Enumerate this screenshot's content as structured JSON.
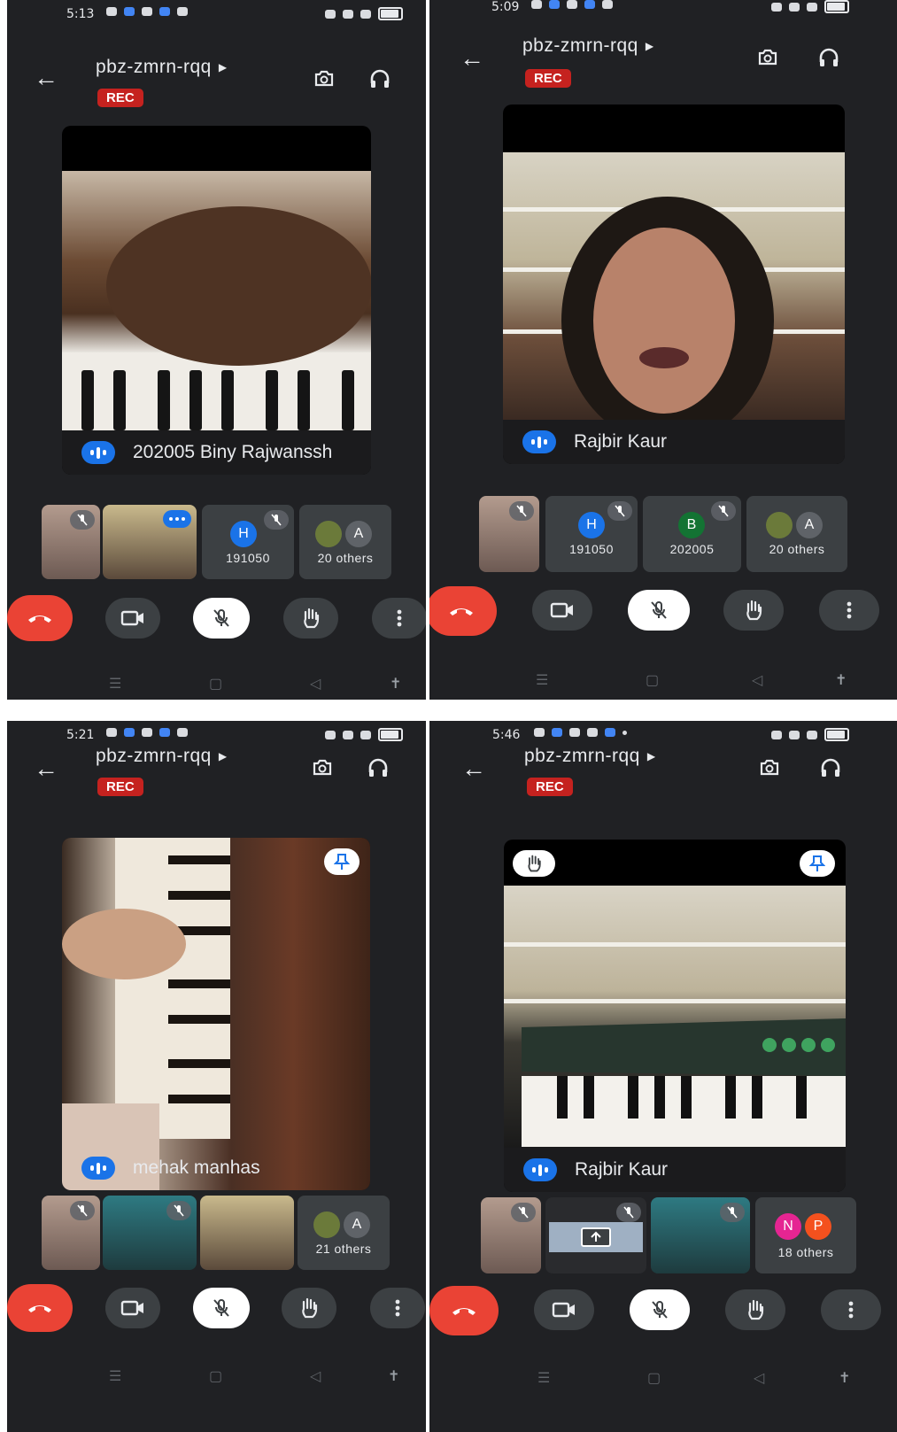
{
  "call": {
    "meeting_code": "pbz-zmrn-rqq",
    "rec_label": "REC"
  },
  "screens": [
    {
      "time": "5:13",
      "main_name": "202005 Biny Rajwanssh",
      "tiles": [
        {
          "type": "video",
          "muted": true
        },
        {
          "type": "video",
          "more": true
        },
        {
          "type": "avatar",
          "letter": "H",
          "color": "#1a73e8",
          "label": "191050",
          "muted": true
        },
        {
          "type": "others",
          "letter": "A",
          "color": "#5f6368",
          "label": "20 others"
        }
      ]
    },
    {
      "time": "5:09",
      "main_name": "Rajbir Kaur",
      "tiles": [
        {
          "type": "video",
          "muted": true
        },
        {
          "type": "avatar",
          "letter": "H",
          "color": "#1a73e8",
          "label": "191050",
          "muted": true
        },
        {
          "type": "avatar",
          "letter": "B",
          "color": "#137333",
          "label": "202005",
          "muted": true
        },
        {
          "type": "others",
          "letter": "A",
          "color": "#5f6368",
          "label": "20 others"
        }
      ]
    },
    {
      "time": "5:21",
      "main_name": "mehak manhas",
      "tiles": [
        {
          "type": "video",
          "muted": true
        },
        {
          "type": "video",
          "muted": true
        },
        {
          "type": "video"
        },
        {
          "type": "others",
          "letter": "A",
          "color": "#5f6368",
          "label": "21 others"
        }
      ]
    },
    {
      "time": "5:46",
      "main_name": "Rajbir Kaur",
      "tiles": [
        {
          "type": "video",
          "muted": true
        },
        {
          "type": "present",
          "muted": true
        },
        {
          "type": "video",
          "muted": true
        },
        {
          "type": "others2",
          "letters": [
            "N",
            "P"
          ],
          "colors": [
            "#e52592",
            "#f4511e"
          ],
          "label": "18 others"
        }
      ]
    }
  ],
  "colors": {
    "background": "#202124",
    "end_call": "#ea4335",
    "rec": "#c5221f",
    "accent": "#1a73e8"
  },
  "icons": {
    "back": "arrow-left-icon",
    "switch_camera": "switch-camera-icon",
    "audio": "headphones-icon",
    "end_call": "phone-hangup-icon",
    "camera": "video-camera-icon",
    "mic_off": "mic-off-icon",
    "raise_hand": "hand-icon",
    "more": "more-vert-icon",
    "pin": "pin-icon"
  }
}
